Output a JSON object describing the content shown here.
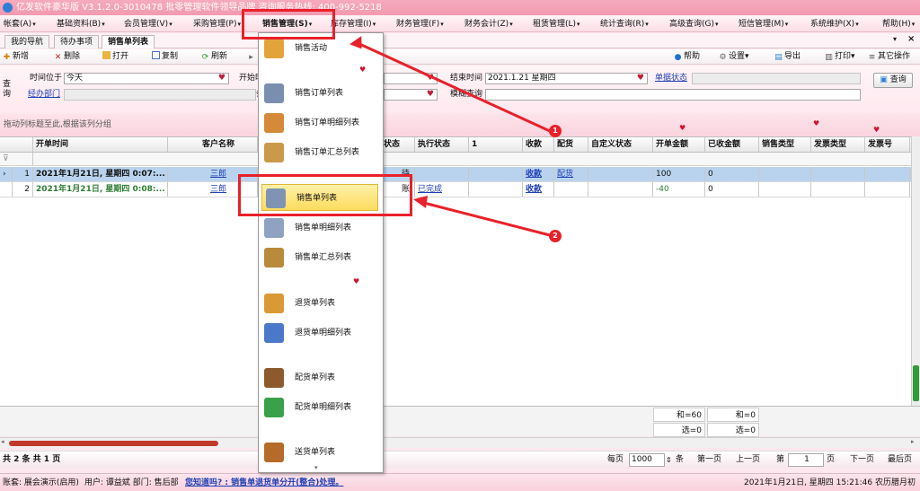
{
  "titlebar": {
    "text": "亿发软件豪华版 V3.1.2.0-3010478 批零管理软件领导品牌 咨询服务热线: 400-992-5218"
  },
  "menu": [
    {
      "label": "帐套(A)"
    },
    {
      "label": "基础资料(B)"
    },
    {
      "label": "会员管理(V)"
    },
    {
      "label": "采购管理(P)"
    },
    {
      "label": "销售管理(S)"
    },
    {
      "label": "库存管理(I)"
    },
    {
      "label": "财务管理(F)"
    },
    {
      "label": "财务会计(Z)"
    },
    {
      "label": "租赁管理(L)"
    },
    {
      "label": "统计查询(R)"
    },
    {
      "label": "高级查询(G)"
    },
    {
      "label": "短信管理(M)"
    },
    {
      "label": "系统维护(X)"
    },
    {
      "label": "帮助(H)"
    }
  ],
  "tabs": [
    {
      "label": "我的导航"
    },
    {
      "label": "待办事项"
    },
    {
      "label": "销售单列表"
    }
  ],
  "toolbar": {
    "new": "新增",
    "delete": "删除",
    "open": "打开",
    "copy": "复制",
    "refresh": "刷新",
    "help": "帮助",
    "settings": "设置",
    "export": "导出",
    "print": "打印",
    "other": "其它操作"
  },
  "filter": {
    "query_side": "查询",
    "time_label": "时间位于",
    "time_value": "今天",
    "start_label": "开始时",
    "end_label": "结束时间",
    "end_value": "2021.1.21 星期四",
    "status_link": "单据状态",
    "dept_link": "经办部门",
    "cond_label": "条",
    "fuzzy_label": "模糊查询",
    "query_button": "查询"
  },
  "group_hint": "拖动列标题至此,根据该列分组",
  "grid": {
    "columns": [
      "开单时间",
      "客户名称",
      "据状态",
      "执行状态",
      "1",
      "收款",
      "配货",
      "自定义状态",
      "开单金额",
      "已收金额",
      "销售类型",
      "发票类型",
      "发票号",
      "未"
    ],
    "rows": [
      {
        "no": "1",
        "date": "2021年1月21日, 星期四 0:07:...",
        "customer": "三郎",
        "status": "待",
        "exec": "",
        "c1": "",
        "pay": "收款",
        "dist": "配货",
        "custom": "",
        "amount": "100",
        "received": "0",
        "extra": "10"
      },
      {
        "no": "2",
        "date": "2021年1月21日, 星期四 0:08:...",
        "customer": "三郎",
        "status": "账",
        "exec": "已完成",
        "c1": "",
        "pay": "收款",
        "dist": "",
        "custom": "",
        "amount": "-40",
        "received": "0",
        "extra": "-4"
      }
    ],
    "sum_amount": "和=60",
    "sum_received": "和=0",
    "sel_amount": "选=0",
    "sel_received": "选=0"
  },
  "pager": {
    "total": "共 2 条  共 1 页",
    "per_page_label": "每页",
    "per_page_value": "1000",
    "unit": "条",
    "first": "第一页",
    "prev": "上一页",
    "page_label": "第",
    "page_value": "1",
    "page_unit": "页",
    "next": "下一页",
    "last": "最后页"
  },
  "statusbar": {
    "account": "账套: 展会演示(启用)",
    "user": "用户: 谭益斌  部门: 售后部",
    "tip": "您知道吗? : 销售单退货单分开(整合)处理。",
    "datetime": "2021年1月21日, 星期四 15:21:46 农历腊月初九"
  },
  "dropdown": [
    {
      "label": "销售活动",
      "icon": "megaphone-icon",
      "color": "#e2a33b"
    },
    {
      "label": "销售订单列表",
      "icon": "order-list-icon",
      "color": "#7a8fb0"
    },
    {
      "label": "销售订单明细列表",
      "icon": "order-detail-icon",
      "color": "#d58a3a"
    },
    {
      "label": "销售订单汇总列表",
      "icon": "order-summary-icon",
      "color": "#c99a4a"
    },
    {
      "label": "销售单列表",
      "icon": "sales-list-icon",
      "color": "#7f93b5"
    },
    {
      "label": "销售单明细列表",
      "icon": "sales-detail-icon",
      "color": "#8fa2c2"
    },
    {
      "label": "销售单汇总列表",
      "icon": "sales-summary-icon",
      "color": "#b88a3c"
    },
    {
      "label": "退货单列表",
      "icon": "return-list-icon",
      "color": "#d99a35"
    },
    {
      "label": "退货单明细列表",
      "icon": "return-detail-icon",
      "color": "#4b78c8"
    },
    {
      "label": "配货单列表",
      "icon": "distribution-icon",
      "color": "#8c5a2c"
    },
    {
      "label": "配货单明细列表",
      "icon": "distribution-detail-icon",
      "color": "#3aa14a"
    },
    {
      "label": "送货单列表",
      "icon": "delivery-icon",
      "color": "#b56b2a"
    }
  ],
  "annotations": {
    "badge1": "1",
    "badge2": "2"
  }
}
